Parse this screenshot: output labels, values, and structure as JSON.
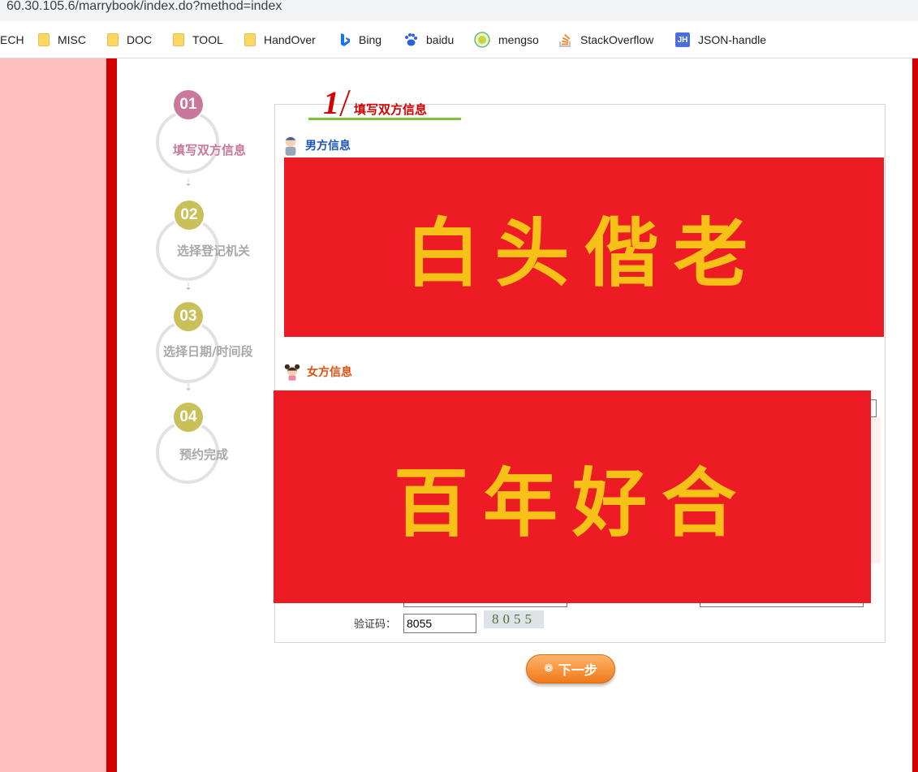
{
  "browser": {
    "url": "60.30.105.6/marrybook/index.do?method=index",
    "bookmarks": [
      {
        "label": "ECH",
        "icon": "none"
      },
      {
        "label": "MISC",
        "icon": "folder-icon"
      },
      {
        "label": "DOC",
        "icon": "folder-icon"
      },
      {
        "label": "TOOL",
        "icon": "folder-icon"
      },
      {
        "label": "HandOver",
        "icon": "folder-icon"
      },
      {
        "label": "Bing",
        "icon": "bing-icon"
      },
      {
        "label": "baidu",
        "icon": "baidu-paw-icon"
      },
      {
        "label": "mengso",
        "icon": "mengso-icon"
      },
      {
        "label": "StackOverflow",
        "icon": "stackoverflow-icon"
      },
      {
        "label": "JSON-handle",
        "icon": "jh-icon"
      }
    ]
  },
  "steps": [
    {
      "num": "01",
      "label": "填写双方信息",
      "active": true
    },
    {
      "num": "02",
      "label": "选择登记机关",
      "active": false
    },
    {
      "num": "03",
      "label": "选择日期/时间段",
      "active": false
    },
    {
      "num": "04",
      "label": "预约完成",
      "active": false
    }
  ],
  "form": {
    "tab_number": "1",
    "tab_title": "填写双方信息",
    "male_section": "男方信息",
    "female_section": "女方信息",
    "male_redaction_text": "白头偕老",
    "female_redaction_text": "百年好合",
    "captcha_label": "验证码：",
    "captcha_value": "8055",
    "captcha_image_text": "8055",
    "next_button": "下一步"
  },
  "colors": {
    "accent_red": "#d40000",
    "redaction_red": "#ed1c24",
    "redaction_text": "#f7c118",
    "male_heading": "#1a56b8",
    "female_heading": "#e05010",
    "step_active": "#c8789a",
    "step_inactive": "#c9c05a"
  }
}
